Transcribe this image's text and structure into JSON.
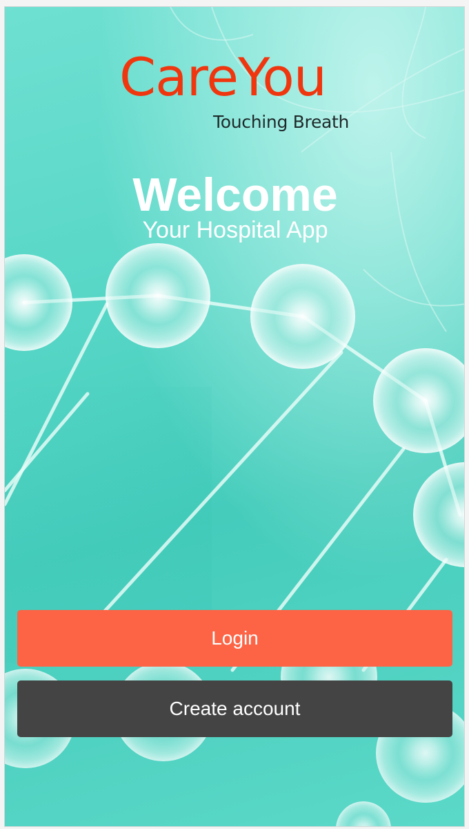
{
  "brand": {
    "name": "CareYou",
    "tagline": "Touching Breath"
  },
  "hero": {
    "title": "Welcome",
    "subtitle": "Your Hospital App"
  },
  "actions": {
    "login_label": "Login",
    "create_account_label": "Create account"
  },
  "colors": {
    "brand": "#f0360e",
    "background": "#52d4c4",
    "login_button": "#fd6446",
    "create_account_button": "#444444",
    "text_light": "#ffffff"
  },
  "icons": {
    "background": "molecule-network-illustration"
  }
}
